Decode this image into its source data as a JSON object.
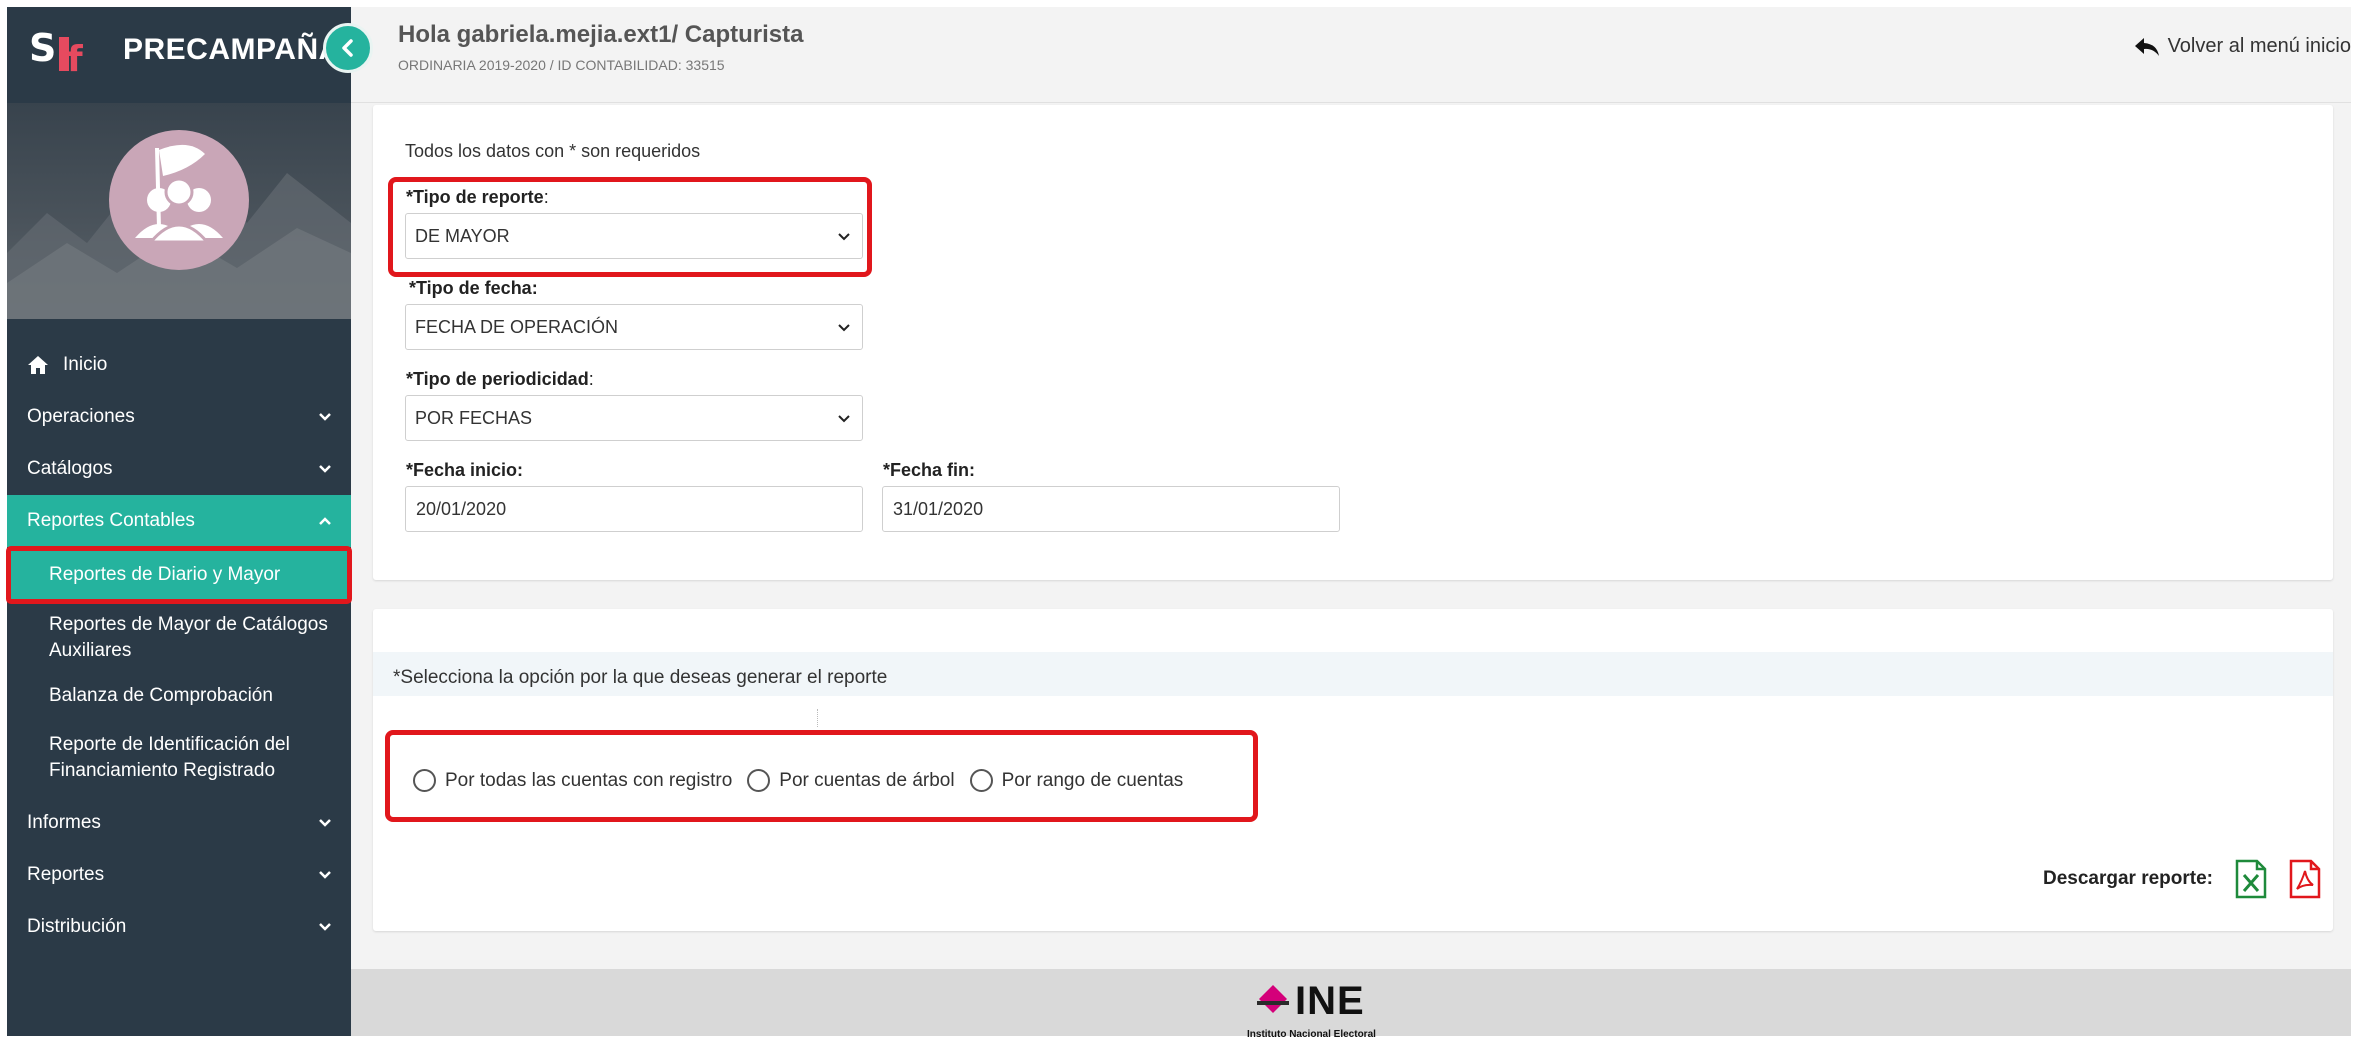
{
  "app": {
    "brand_title": "PRECAMPAÑA",
    "logo_text": "SIF"
  },
  "header": {
    "greeting": "Hola gabriela.mejia.ext1/ Capturista",
    "sub": "ORDINARIA 2019-2020 / ID CONTABILIDAD: 33515",
    "back_label": "Volver al menú inicio"
  },
  "sidebar": {
    "items": [
      {
        "label": "Inicio",
        "icon": "home-icon"
      },
      {
        "label": "Operaciones"
      },
      {
        "label": "Catálogos"
      },
      {
        "label": "Reportes Contables",
        "active": true
      },
      {
        "label": "Informes"
      },
      {
        "label": "Reportes"
      },
      {
        "label": "Distribución"
      }
    ],
    "subitems": [
      {
        "label": "Reportes de Diario y Mayor",
        "selected": true
      },
      {
        "label": "Reportes de Mayor de Catálogos Auxiliares"
      },
      {
        "label": "Balanza de Comprobación"
      },
      {
        "label": "Reporte de Identificación del Financiamiento Registrado"
      }
    ]
  },
  "form": {
    "required_note": "Todos los datos con * son requeridos",
    "tipo_reporte": {
      "label": "*Tipo de reporte",
      "colon": ":",
      "value": "DE MAYOR"
    },
    "tipo_fecha": {
      "label": "*Tipo de fecha:",
      "value": "FECHA DE OPERACIÓN"
    },
    "tipo_periodicidad": {
      "label": "*Tipo de periodicidad",
      "colon": ":",
      "value": "POR FECHAS"
    },
    "fecha_inicio": {
      "label": "*Fecha inicio:",
      "value": "20/01/2020"
    },
    "fecha_fin": {
      "label": "*Fecha fin:",
      "value": "31/01/2020"
    }
  },
  "options": {
    "prompt": "*Selecciona la opción por la que deseas generar el reporte",
    "radios": [
      "Por todas las cuentas con registro",
      "Por cuentas de árbol",
      "Por rango de cuentas"
    ]
  },
  "download": {
    "label": "Descargar reporte:",
    "excel_icon": "excel-icon",
    "pdf_icon": "pdf-icon"
  },
  "footer": {
    "logo_text": "INE",
    "logo_subtext": "Instituto Nacional Electoral"
  },
  "colors": {
    "sidebar": "#2b3a47",
    "accent": "#25b39e",
    "highlight": "#e1171c",
    "ine_pink": "#d4007a"
  }
}
